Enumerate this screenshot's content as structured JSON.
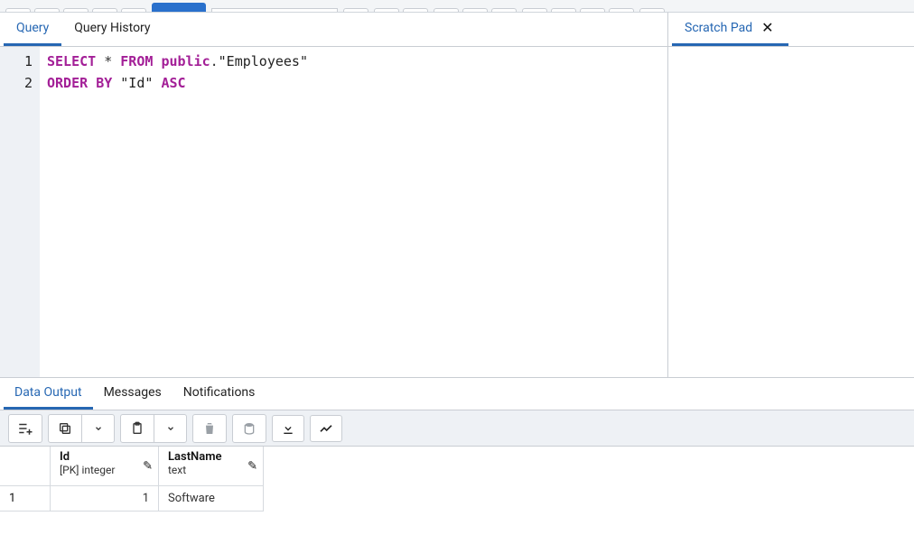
{
  "editor_tabs": {
    "query": "Query",
    "history": "Query History"
  },
  "scratch_tab": {
    "label": "Scratch Pad"
  },
  "code": {
    "lines": [
      {
        "n": "1"
      },
      {
        "n": "2"
      }
    ],
    "tok": {
      "select": "SELECT",
      "star": " * ",
      "from": "FROM",
      "sp": " ",
      "schema": "public",
      "dot": ".",
      "tbl": "\"Employees\"",
      "order": "ORDER",
      "by": "BY",
      "col": "\"Id\"",
      "asc": "ASC"
    }
  },
  "bottom_tabs": {
    "data_output": "Data Output",
    "messages": "Messages",
    "notifications": "Notifications"
  },
  "grid": {
    "cols": [
      {
        "name": "Id",
        "type": "[PK] integer"
      },
      {
        "name": "LastName",
        "type": "text"
      }
    ],
    "rows": [
      {
        "n": "1",
        "id": "1",
        "lastname": "Software"
      }
    ]
  }
}
